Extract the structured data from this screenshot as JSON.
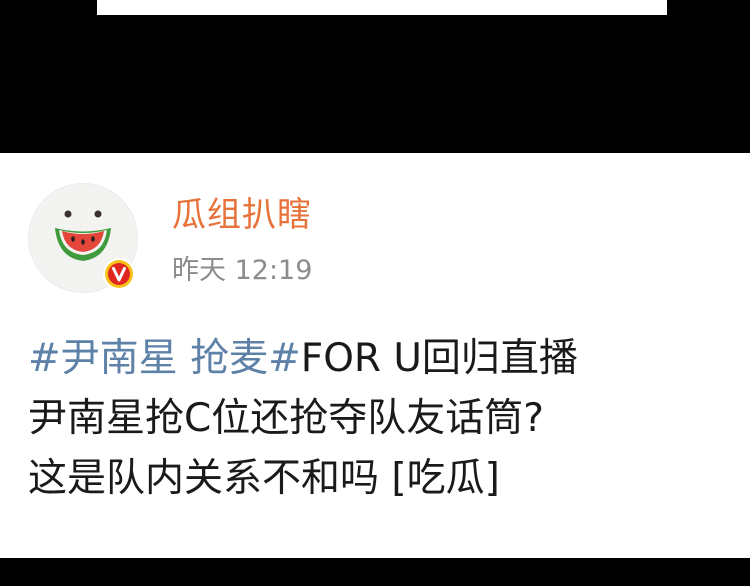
{
  "post": {
    "username": "瓜组扒瞎",
    "timestamp": "昨天 12:19",
    "hashtag_1": "#尹南星 抢麦#",
    "line1_rest": "FOR U回归直播",
    "line2": "尹南星抢C位还抢夺队友话筒?",
    "line3": "这是队内关系不和吗 [吃瓜]"
  },
  "icons": {
    "avatar": "watermelon-face-avatar",
    "badge": "verified-v-badge"
  },
  "colors": {
    "username": "#e8733a",
    "hashtag": "#5e81a8",
    "text": "#1a1a1a",
    "timestamp": "#8c8c8c",
    "badge_fill": "#e0261f",
    "badge_ring": "#f7c31a"
  }
}
